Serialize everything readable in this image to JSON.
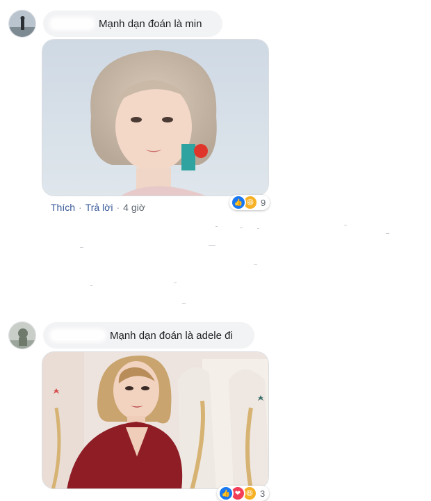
{
  "comments": [
    {
      "text": "Mạnh dạn đoán là min",
      "actions": {
        "like": "Thích",
        "reply": "Trả lời",
        "time": "4 giờ"
      },
      "reaction_count": "9",
      "reactions": [
        "like",
        "haha"
      ]
    },
    {
      "text": "Mạnh dạn đoán là adele đi",
      "reaction_count": "3",
      "reactions": [
        "like",
        "love",
        "haha"
      ]
    }
  ],
  "colors": {
    "like": "#1877f2",
    "love": "#f33e58",
    "haha": "#f7b125",
    "link": "#385898",
    "bubble": "#f2f3f5"
  }
}
